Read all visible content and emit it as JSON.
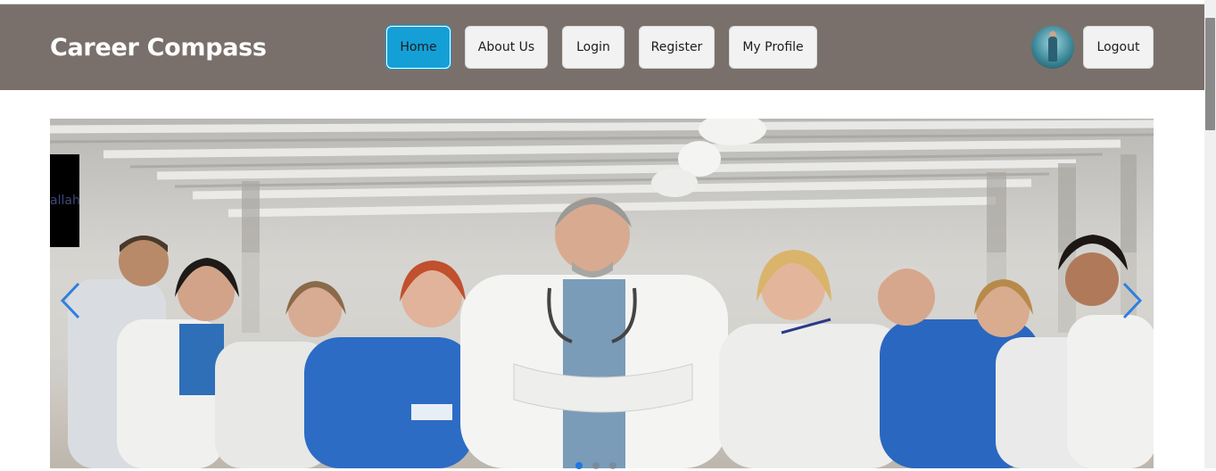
{
  "header": {
    "brand": "Career Compass",
    "nav": [
      {
        "label": "Home",
        "active": true
      },
      {
        "label": "About Us"
      },
      {
        "label": "Login"
      },
      {
        "label": "Register"
      },
      {
        "label": "My Profile"
      }
    ],
    "logout_label": "Logout"
  },
  "carousel": {
    "caption": "allah",
    "slide_count": 3,
    "active_slide": 1
  },
  "colors": {
    "navbar": "#7a706b",
    "active_button": "#14a0d6",
    "arrow": "#2f7fdf"
  }
}
